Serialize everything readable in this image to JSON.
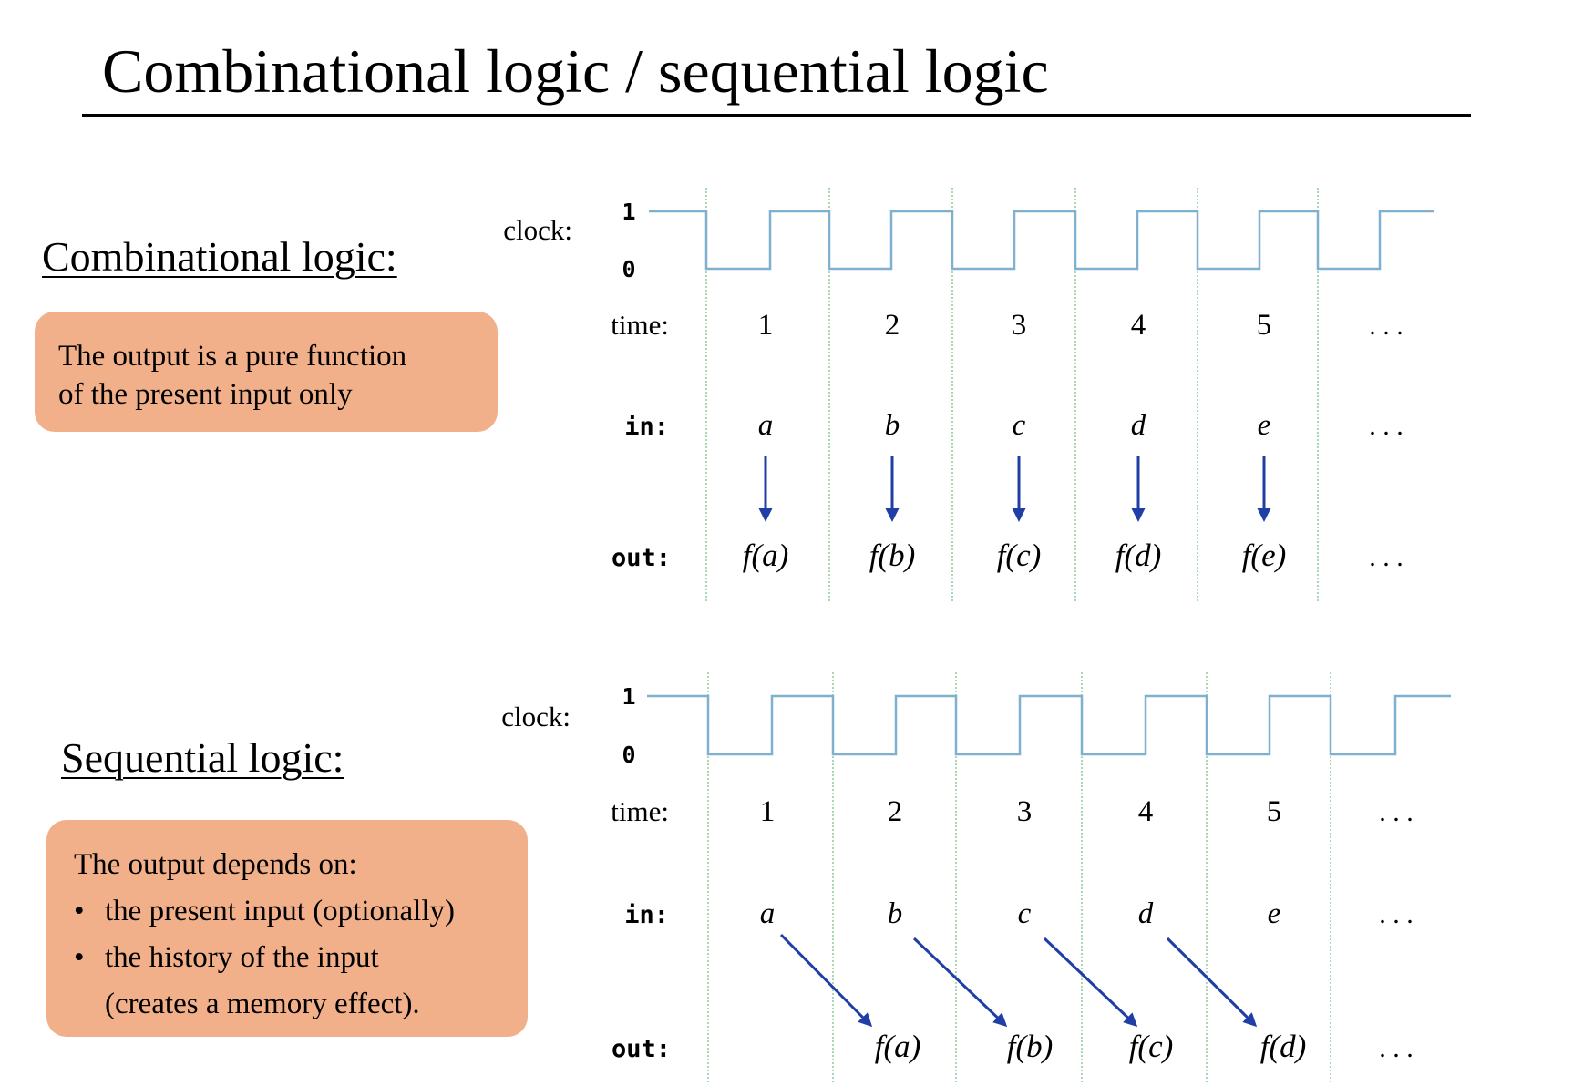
{
  "slide": {
    "title": "Combinational logic / sequential logic"
  },
  "combinational": {
    "heading": "Combinational logic:",
    "callout_lines": [
      "The output is a pure function",
      "of the present input only"
    ]
  },
  "sequential": {
    "heading": "Sequential logic:",
    "callout_intro": "The output depends on:",
    "bullet_mark": "•",
    "bullets": [
      "the present input (optionally)",
      "the history of the input"
    ],
    "bullet_continuation": "(creates a memory effect)."
  },
  "diagram_labels": {
    "clock": "clock:",
    "high": "1",
    "low": "0",
    "time": "time:",
    "in": "in:",
    "out": "out:",
    "ellipsis": ". . ."
  },
  "comb_diagram": {
    "time_values": [
      "1",
      "2",
      "3",
      "4",
      "5"
    ],
    "inputs": [
      "a",
      "b",
      "c",
      "d",
      "e"
    ],
    "outputs": [
      "f(a)",
      "f(b)",
      "f(c)",
      "f(d)",
      "f(e)"
    ]
  },
  "seq_diagram": {
    "time_values": [
      "1",
      "2",
      "3",
      "4",
      "5"
    ],
    "inputs": [
      "a",
      "b",
      "c",
      "d",
      "e"
    ],
    "outputs": [
      "f(a)",
      "f(b)",
      "f(c)",
      "f(d)"
    ]
  },
  "colors": {
    "callout_fill": "#f2b08a",
    "clock_wave": "#7fb0d0",
    "grid_line": "#8fc99a",
    "arrow": "#1f3fa6"
  }
}
